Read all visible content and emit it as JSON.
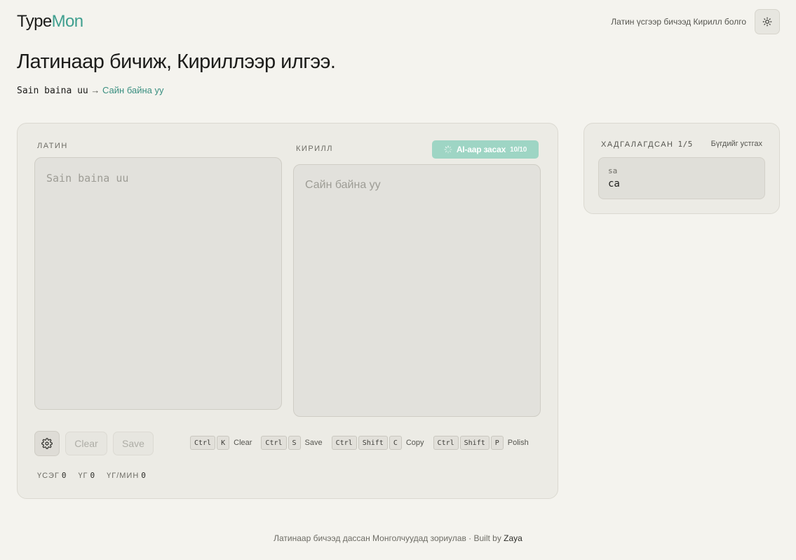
{
  "header": {
    "logo_part1": "Type",
    "logo_part2": "Mon",
    "tagline": "Латин үсгээр бичээд Кирилл болго",
    "theme_icon": "sun-icon"
  },
  "hero": {
    "headline": "Латинаар бичиж, Кириллээр илгээ.",
    "example_input": "Sain baina uu",
    "example_arrow": "→",
    "example_output": "Сайн байна уу"
  },
  "editor": {
    "latin_label": "ЛАТИН",
    "latin_placeholder": "Sain baina uu",
    "cyrillic_label": "КИРИЛЛ",
    "cyrillic_placeholder": "Сайн байна уу",
    "ai_button": {
      "label": "AI-аар засах",
      "count": "10/10",
      "icon": "spinner-icon"
    },
    "settings_icon": "gear-icon",
    "clear_label": "Clear",
    "save_label": "Save",
    "shortcuts": [
      {
        "keys": [
          "Ctrl",
          "K"
        ],
        "label": "Clear"
      },
      {
        "keys": [
          "Ctrl",
          "S"
        ],
        "label": "Save"
      },
      {
        "keys": [
          "Ctrl",
          "Shift",
          "C"
        ],
        "label": "Copy"
      },
      {
        "keys": [
          "Ctrl",
          "Shift",
          "P"
        ],
        "label": "Polish"
      }
    ],
    "stats": [
      {
        "label": "ҮСЭГ",
        "value": "0"
      },
      {
        "label": "ҮГ",
        "value": "0"
      },
      {
        "label": "ҮГ/МИН",
        "value": "0"
      }
    ]
  },
  "saved": {
    "title": "ХАДГАЛАГДСАН",
    "count": "1/5",
    "clear_all": "Бүгдийг устгах",
    "items": [
      {
        "latin": "sa",
        "cyrillic": "са"
      }
    ]
  },
  "footer": {
    "text": "Латинаар бичээд дассан Монголчуудад зориулав · Built by ",
    "author": "Zaya"
  },
  "colors": {
    "background": "#f4f3ee",
    "accent": "#3f9f8f",
    "ai_button": "#9ed5c4"
  }
}
